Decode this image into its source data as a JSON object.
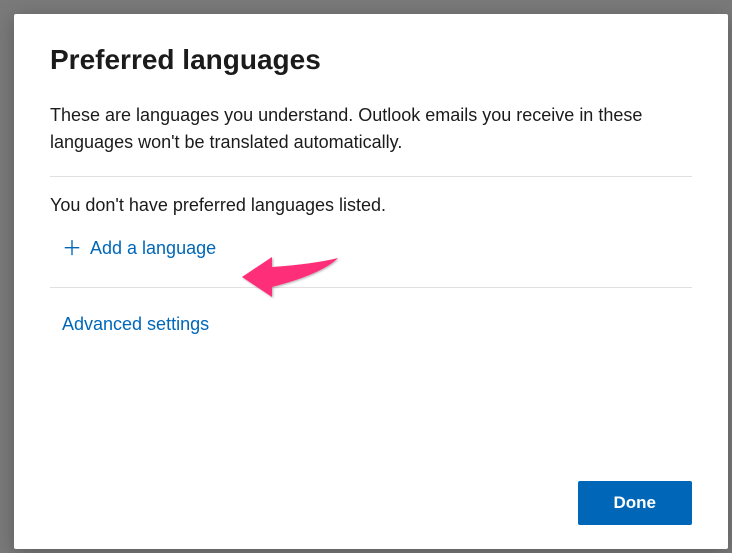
{
  "modal": {
    "title": "Preferred languages",
    "description": "These are languages you understand. Outlook emails you receive in these languages won't be translated automatically.",
    "empty_status": "You don't have preferred languages listed.",
    "add_language_label": "Add a language",
    "advanced_label": "Advanced settings",
    "done_label": "Done"
  }
}
